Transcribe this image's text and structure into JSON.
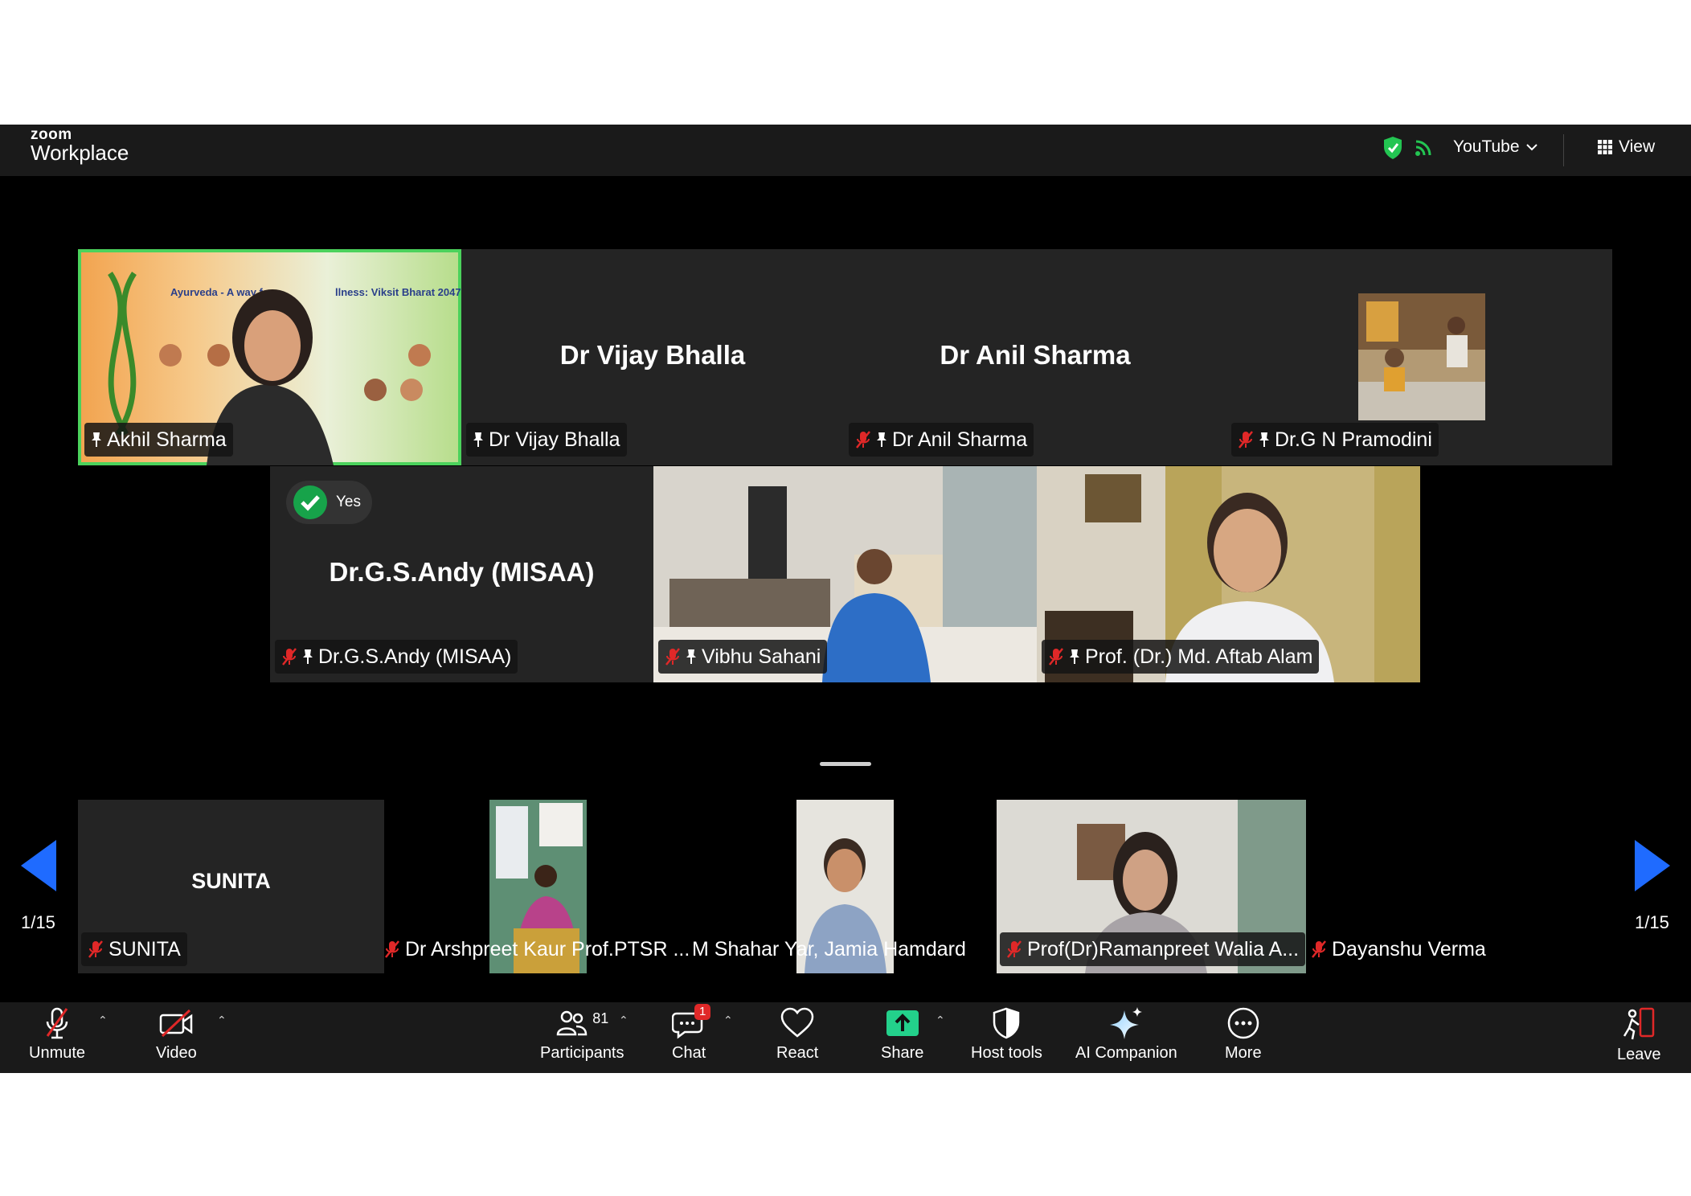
{
  "app": {
    "brand_small": "zoom",
    "brand": "Workplace"
  },
  "topbar": {
    "stream": "YouTube",
    "view": "View"
  },
  "gallery": {
    "speaker": "Akhil Sharma",
    "tiles": [
      {
        "big": "Dr Vijay Bhalla",
        "label": "Dr Vijay Bhalla"
      },
      {
        "big": "Dr Anil Sharma",
        "label": "Dr Anil Sharma"
      },
      {
        "label": "Dr.G N Pramodini"
      },
      {
        "big": "Dr.G.S.Andy (MISAA)",
        "label": "Dr.G.S.Andy (MISAA)",
        "reaction": "Yes"
      },
      {
        "label": "Vibhu Sahani"
      },
      {
        "label": "Prof. (Dr.) Md. Aftab Alam"
      }
    ]
  },
  "strip": {
    "page_left": "1/15",
    "page_right": "1/15",
    "tiles": [
      {
        "big": "SUNITA",
        "label": "SUNITA"
      },
      {
        "label": "Dr Arshpreet Kaur Prof.PTSR ..."
      },
      {
        "label": "M Shahar Yar, Jamia Hamdard"
      },
      {
        "label": "Prof(Dr)Ramanpreet Walia A..."
      },
      {
        "label": "Dayanshu Verma"
      }
    ]
  },
  "toolbar": {
    "unmute": "Unmute",
    "video": "Video",
    "participants": "Participants",
    "participants_count": "81",
    "chat": "Chat",
    "chat_badge": "1",
    "react": "React",
    "share": "Share",
    "host_tools": "Host tools",
    "ai_companion": "AI Companion",
    "more": "More",
    "leave": "Leave"
  },
  "colors": {
    "speaker_border": "#4bd25c",
    "accent_blue": "#1f6bff",
    "share_green": "#23d18b",
    "muted_red": "#e02828",
    "badge_red": "#e02828"
  }
}
